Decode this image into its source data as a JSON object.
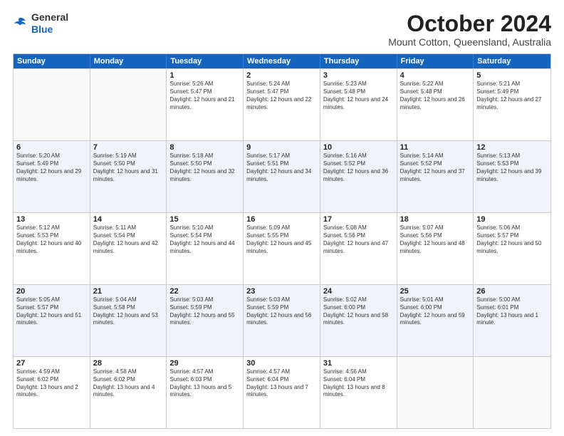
{
  "logo": {
    "general": "General",
    "blue": "Blue"
  },
  "title": "October 2024",
  "location": "Mount Cotton, Queensland, Australia",
  "days_of_week": [
    "Sunday",
    "Monday",
    "Tuesday",
    "Wednesday",
    "Thursday",
    "Friday",
    "Saturday"
  ],
  "weeks": [
    [
      {
        "day": null,
        "sunrise": null,
        "sunset": null,
        "daylight": null
      },
      {
        "day": null,
        "sunrise": null,
        "sunset": null,
        "daylight": null
      },
      {
        "day": "1",
        "sunrise": "5:26 AM",
        "sunset": "5:47 PM",
        "daylight": "12 hours and 21 minutes."
      },
      {
        "day": "2",
        "sunrise": "5:24 AM",
        "sunset": "5:47 PM",
        "daylight": "12 hours and 22 minutes."
      },
      {
        "day": "3",
        "sunrise": "5:23 AM",
        "sunset": "5:48 PM",
        "daylight": "12 hours and 24 minutes."
      },
      {
        "day": "4",
        "sunrise": "5:22 AM",
        "sunset": "5:48 PM",
        "daylight": "12 hours and 26 minutes."
      },
      {
        "day": "5",
        "sunrise": "5:21 AM",
        "sunset": "5:49 PM",
        "daylight": "12 hours and 27 minutes."
      }
    ],
    [
      {
        "day": "6",
        "sunrise": "5:20 AM",
        "sunset": "5:49 PM",
        "daylight": "12 hours and 29 minutes."
      },
      {
        "day": "7",
        "sunrise": "5:19 AM",
        "sunset": "5:50 PM",
        "daylight": "12 hours and 31 minutes."
      },
      {
        "day": "8",
        "sunrise": "5:18 AM",
        "sunset": "5:50 PM",
        "daylight": "12 hours and 32 minutes."
      },
      {
        "day": "9",
        "sunrise": "5:17 AM",
        "sunset": "5:51 PM",
        "daylight": "12 hours and 34 minutes."
      },
      {
        "day": "10",
        "sunrise": "5:16 AM",
        "sunset": "5:52 PM",
        "daylight": "12 hours and 36 minutes."
      },
      {
        "day": "11",
        "sunrise": "5:14 AM",
        "sunset": "5:52 PM",
        "daylight": "12 hours and 37 minutes."
      },
      {
        "day": "12",
        "sunrise": "5:13 AM",
        "sunset": "5:53 PM",
        "daylight": "12 hours and 39 minutes."
      }
    ],
    [
      {
        "day": "13",
        "sunrise": "5:12 AM",
        "sunset": "5:53 PM",
        "daylight": "12 hours and 40 minutes."
      },
      {
        "day": "14",
        "sunrise": "5:11 AM",
        "sunset": "5:54 PM",
        "daylight": "12 hours and 42 minutes."
      },
      {
        "day": "15",
        "sunrise": "5:10 AM",
        "sunset": "5:54 PM",
        "daylight": "12 hours and 44 minutes."
      },
      {
        "day": "16",
        "sunrise": "5:09 AM",
        "sunset": "5:55 PM",
        "daylight": "12 hours and 45 minutes."
      },
      {
        "day": "17",
        "sunrise": "5:08 AM",
        "sunset": "5:56 PM",
        "daylight": "12 hours and 47 minutes."
      },
      {
        "day": "18",
        "sunrise": "5:07 AM",
        "sunset": "5:56 PM",
        "daylight": "12 hours and 48 minutes."
      },
      {
        "day": "19",
        "sunrise": "5:06 AM",
        "sunset": "5:57 PM",
        "daylight": "12 hours and 50 minutes."
      }
    ],
    [
      {
        "day": "20",
        "sunrise": "5:05 AM",
        "sunset": "5:57 PM",
        "daylight": "12 hours and 51 minutes."
      },
      {
        "day": "21",
        "sunrise": "5:04 AM",
        "sunset": "5:58 PM",
        "daylight": "12 hours and 53 minutes."
      },
      {
        "day": "22",
        "sunrise": "5:03 AM",
        "sunset": "5:59 PM",
        "daylight": "12 hours and 55 minutes."
      },
      {
        "day": "23",
        "sunrise": "5:03 AM",
        "sunset": "5:59 PM",
        "daylight": "12 hours and 56 minutes."
      },
      {
        "day": "24",
        "sunrise": "5:02 AM",
        "sunset": "6:00 PM",
        "daylight": "12 hours and 58 minutes."
      },
      {
        "day": "25",
        "sunrise": "5:01 AM",
        "sunset": "6:00 PM",
        "daylight": "12 hours and 59 minutes."
      },
      {
        "day": "26",
        "sunrise": "5:00 AM",
        "sunset": "6:01 PM",
        "daylight": "13 hours and 1 minute."
      }
    ],
    [
      {
        "day": "27",
        "sunrise": "4:59 AM",
        "sunset": "6:02 PM",
        "daylight": "13 hours and 2 minutes."
      },
      {
        "day": "28",
        "sunrise": "4:58 AM",
        "sunset": "6:02 PM",
        "daylight": "13 hours and 4 minutes."
      },
      {
        "day": "29",
        "sunrise": "4:57 AM",
        "sunset": "6:03 PM",
        "daylight": "13 hours and 5 minutes."
      },
      {
        "day": "30",
        "sunrise": "4:57 AM",
        "sunset": "6:04 PM",
        "daylight": "13 hours and 7 minutes."
      },
      {
        "day": "31",
        "sunrise": "4:56 AM",
        "sunset": "6:04 PM",
        "daylight": "13 hours and 8 minutes."
      },
      {
        "day": null,
        "sunrise": null,
        "sunset": null,
        "daylight": null
      },
      {
        "day": null,
        "sunrise": null,
        "sunset": null,
        "daylight": null
      }
    ]
  ]
}
